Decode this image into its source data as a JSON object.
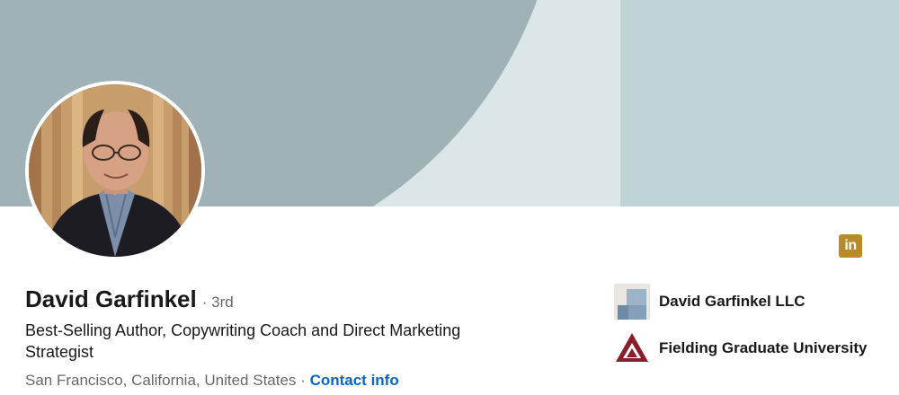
{
  "profile": {
    "name": "David Garfinkel",
    "degree": "· 3rd",
    "headline": "Best-Selling Author, Copywriting Coach and Direct Marketing Strategist",
    "location": "San Francisco, California, United States",
    "separator": "·",
    "contact_label": "Contact info"
  },
  "badge": {
    "label": "in",
    "icon": "linkedin-icon",
    "color": "#b88a29"
  },
  "organizations": [
    {
      "name": "David Garfinkel LLC",
      "icon": "company-logo-placeholder"
    },
    {
      "name": "Fielding Graduate University",
      "icon": "fielding-logo"
    }
  ],
  "colors": {
    "link": "#0a66c2",
    "banner_light": "#dbe6e8",
    "banner_dark": "#a1b2b6",
    "banner_panel": "#c0d4d8"
  }
}
